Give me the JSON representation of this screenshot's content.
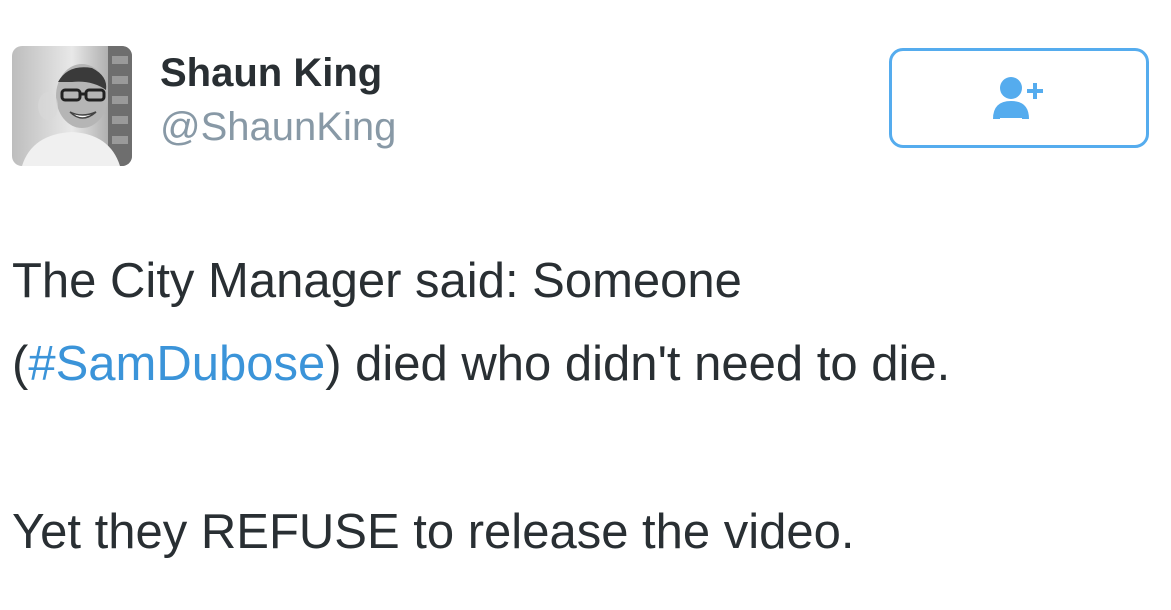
{
  "user": {
    "display_name": "Shaun King",
    "screen_name": "@ShaunKing",
    "avatar_icon": "profile-photo"
  },
  "follow_button": {
    "icon": "follow-user-plus-icon",
    "accent_color": "#55acee"
  },
  "tweet": {
    "line1": "The City Manager said: Someone",
    "line2_open_paren": "(",
    "hashtag": "#SamDubose",
    "line2_rest": ") died who didn't need to die.",
    "line3": "Yet they REFUSE to release the video.",
    "hashtag_color": "#3b94d9"
  }
}
